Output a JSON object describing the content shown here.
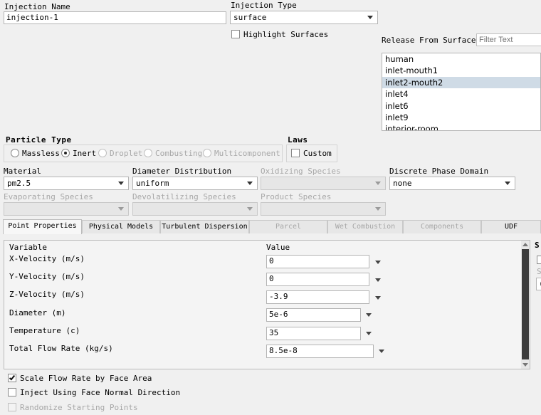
{
  "injection_name": {
    "label": "Injection Name",
    "value": "injection-1"
  },
  "injection_type": {
    "label": "Injection Type",
    "value": "surface"
  },
  "highlight_surfaces": {
    "label": "Highlight Surfaces",
    "checked": false
  },
  "release_from_surfaces": {
    "label": "Release From Surfaces",
    "filter_placeholder": "Filter Text",
    "items": [
      "human",
      "inlet-mouth1",
      "inlet2-mouth2",
      "inlet4",
      "inlet6",
      "inlet9",
      "interior-room"
    ],
    "selected": "inlet2-mouth2"
  },
  "particle_type": {
    "label": "Particle Type",
    "options": [
      "Massless",
      "Inert",
      "Droplet",
      "Combusting",
      "Multicomponent"
    ],
    "selected": "Inert"
  },
  "laws": {
    "label": "Laws",
    "custom_label": "Custom"
  },
  "material": {
    "label": "Material",
    "value": "pm2.5"
  },
  "diameter_distribution": {
    "label": "Diameter Distribution",
    "value": "uniform"
  },
  "oxidizing_species": {
    "label": "Oxidizing Species",
    "value": ""
  },
  "discrete_phase_domain": {
    "label": "Discrete Phase Domain",
    "value": "none"
  },
  "evaporating_species": {
    "label": "Evaporating Species",
    "value": ""
  },
  "devolatilizing_species": {
    "label": "Devolatilizing Species",
    "value": ""
  },
  "product_species": {
    "label": "Product Species",
    "value": ""
  },
  "tabs": [
    "Point Properties",
    "Physical Models",
    "Turbulent Dispersion",
    "Parcel",
    "Wet Combustion",
    "Components",
    "UDF"
  ],
  "point_properties": {
    "variable_header": "Variable",
    "value_header": "Value",
    "rows": [
      {
        "variable": "X-Velocity (m/s)",
        "value": "0"
      },
      {
        "variable": "Y-Velocity (m/s)",
        "value": "0"
      },
      {
        "variable": "Z-Velocity (m/s)",
        "value": "-3.9"
      },
      {
        "variable": "Diameter (m)",
        "value": "5e-6"
      },
      {
        "variable": "Temperature (c)",
        "value": "35"
      },
      {
        "variable": "Total Flow Rate (kg/s)",
        "value": "8.5e-8"
      }
    ]
  },
  "side_panel": {
    "title": "S",
    "sub": "S",
    "field": "("
  },
  "scale_flow_rate": {
    "label": "Scale Flow Rate by Face Area",
    "checked": true
  },
  "inject_face_normal": {
    "label": "Inject Using Face Normal Direction",
    "checked": false
  },
  "randomize_starting": {
    "label": "Randomize Starting Points",
    "checked": false
  }
}
